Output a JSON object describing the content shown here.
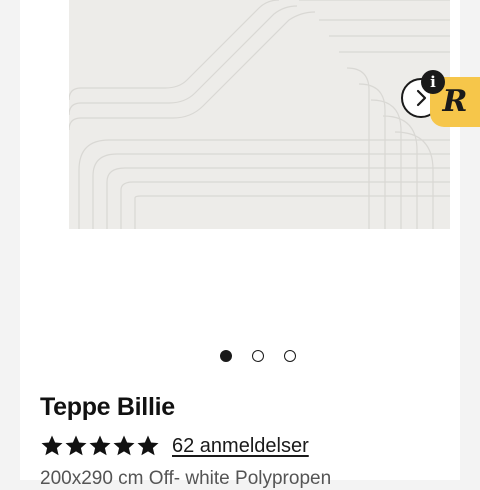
{
  "product": {
    "title": "Teppe Billie",
    "rating": 5,
    "rating_max": 5,
    "reviews_label": "62 anmeldelser",
    "description": "200x290 cm Off- white Polypropen"
  },
  "gallery": {
    "slide_count": 3,
    "active_slide": 1,
    "next_icon": "chevron-right-icon"
  },
  "overlay_badge": {
    "letter": "R",
    "info_glyph": "i",
    "color": "#f6c64a"
  }
}
